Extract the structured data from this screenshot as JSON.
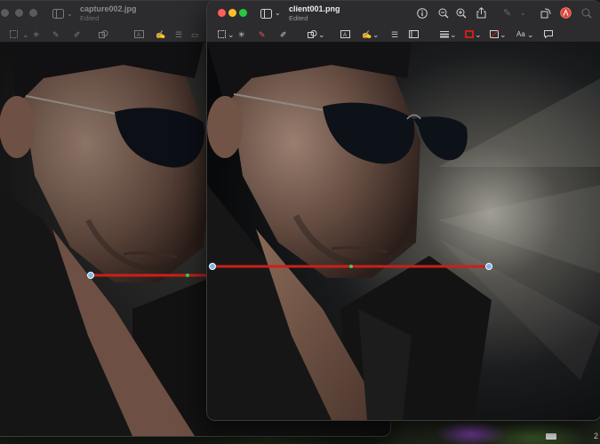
{
  "back_window": {
    "file_name": "capture002.jpg",
    "status": "Edited"
  },
  "front_window": {
    "file_name": "client001.png",
    "status": "Edited",
    "toolbar_right": [
      "info-icon",
      "zoom-out-icon",
      "zoom-in-icon",
      "share-icon",
      "highlight-icon",
      "rotate-icon",
      "markup-icon",
      "search-icon"
    ],
    "markup_tools": [
      "rect-select-icon",
      "lasso-icon",
      "sketch-icon",
      "draw-icon",
      "shapes-icon",
      "text-icon",
      "sign-icon",
      "adjust-color-icon",
      "crop-icon",
      "line-style-icon",
      "border-color-icon",
      "fill-color-icon",
      "font-icon",
      "note-icon"
    ],
    "font_label": "Aa",
    "accent_color": "#cc1f1a"
  },
  "desktop": {
    "corner_text": "2"
  }
}
